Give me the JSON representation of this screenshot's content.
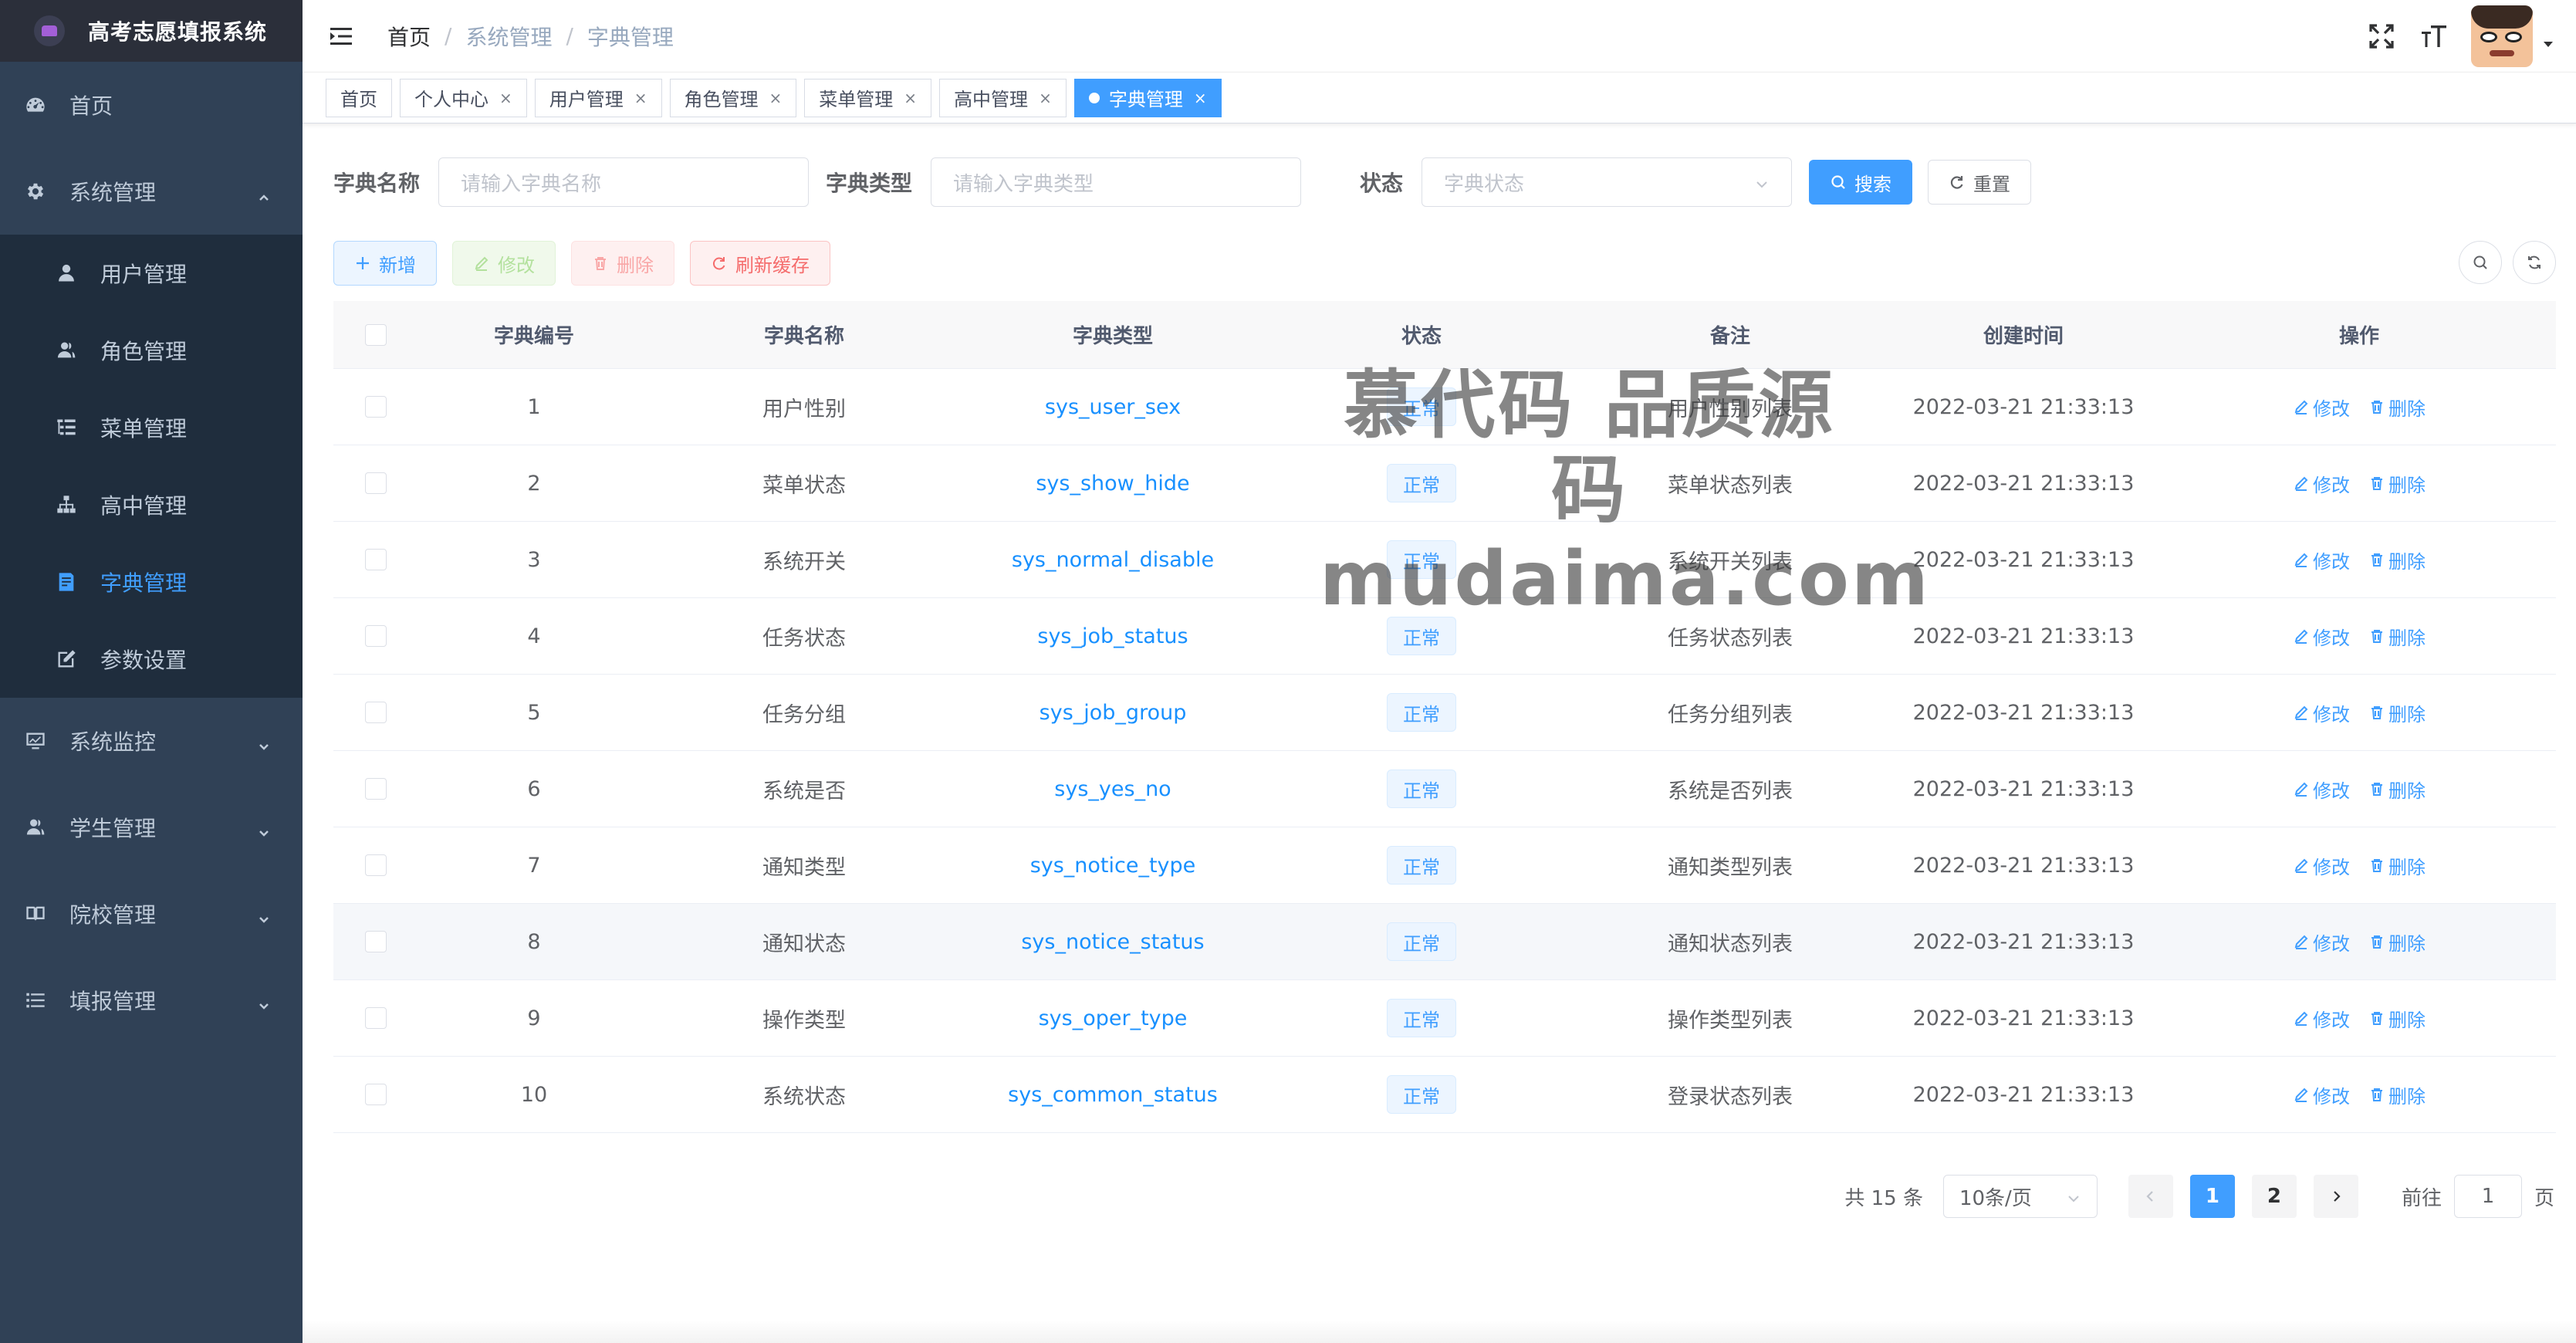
{
  "app": {
    "title": "高考志愿填报系统"
  },
  "sidebar": {
    "items": [
      {
        "label": "首页",
        "icon": "dashboard-icon"
      },
      {
        "label": "系统管理",
        "icon": "gear-icon",
        "expanded": true
      },
      {
        "label": "系统监控",
        "icon": "monitor-icon"
      },
      {
        "label": "学生管理",
        "icon": "peoples-icon"
      },
      {
        "label": "院校管理",
        "icon": "book-icon"
      },
      {
        "label": "填报管理",
        "icon": "list-icon"
      }
    ],
    "sub_items": [
      {
        "label": "用户管理",
        "icon": "user-icon"
      },
      {
        "label": "角色管理",
        "icon": "peoples-icon"
      },
      {
        "label": "菜单管理",
        "icon": "tree-table-icon"
      },
      {
        "label": "高中管理",
        "icon": "tree-icon"
      },
      {
        "label": "字典管理",
        "icon": "dict-icon",
        "active": true
      },
      {
        "label": "参数设置",
        "icon": "edit-icon"
      }
    ]
  },
  "breadcrumb": [
    "首页",
    "系统管理",
    "字典管理"
  ],
  "tags": [
    {
      "label": "首页"
    },
    {
      "label": "个人中心"
    },
    {
      "label": "用户管理"
    },
    {
      "label": "角色管理"
    },
    {
      "label": "菜单管理"
    },
    {
      "label": "高中管理"
    },
    {
      "label": "字典管理",
      "active": true
    }
  ],
  "search": {
    "name_label": "字典名称",
    "name_placeholder": "请输入字典名称",
    "type_label": "字典类型",
    "type_placeholder": "请输入字典类型",
    "status_label": "状态",
    "status_placeholder": "字典状态",
    "search_btn": "搜索",
    "reset_btn": "重置"
  },
  "toolbar": {
    "add": "新增",
    "edit": "修改",
    "delete": "删除",
    "refresh_cache": "刷新缓存"
  },
  "table": {
    "headers": [
      "字典编号",
      "字典名称",
      "字典类型",
      "状态",
      "备注",
      "创建时间",
      "操作"
    ],
    "rows": [
      {
        "id": "1",
        "name": "用户性别",
        "type": "sys_user_sex",
        "status": "正常",
        "remark": "用户性别列表",
        "time": "2022-03-21 21:33:13"
      },
      {
        "id": "2",
        "name": "菜单状态",
        "type": "sys_show_hide",
        "status": "正常",
        "remark": "菜单状态列表",
        "time": "2022-03-21 21:33:13"
      },
      {
        "id": "3",
        "name": "系统开关",
        "type": "sys_normal_disable",
        "status": "正常",
        "remark": "系统开关列表",
        "time": "2022-03-21 21:33:13"
      },
      {
        "id": "4",
        "name": "任务状态",
        "type": "sys_job_status",
        "status": "正常",
        "remark": "任务状态列表",
        "time": "2022-03-21 21:33:13"
      },
      {
        "id": "5",
        "name": "任务分组",
        "type": "sys_job_group",
        "status": "正常",
        "remark": "任务分组列表",
        "time": "2022-03-21 21:33:13"
      },
      {
        "id": "6",
        "name": "系统是否",
        "type": "sys_yes_no",
        "status": "正常",
        "remark": "系统是否列表",
        "time": "2022-03-21 21:33:13"
      },
      {
        "id": "7",
        "name": "通知类型",
        "type": "sys_notice_type",
        "status": "正常",
        "remark": "通知类型列表",
        "time": "2022-03-21 21:33:13"
      },
      {
        "id": "8",
        "name": "通知状态",
        "type": "sys_notice_status",
        "status": "正常",
        "remark": "通知状态列表",
        "time": "2022-03-21 21:33:13"
      },
      {
        "id": "9",
        "name": "操作类型",
        "type": "sys_oper_type",
        "status": "正常",
        "remark": "操作类型列表",
        "time": "2022-03-21 21:33:13"
      },
      {
        "id": "10",
        "name": "系统状态",
        "type": "sys_common_status",
        "status": "正常",
        "remark": "登录状态列表",
        "time": "2022-03-21 21:33:13"
      }
    ],
    "op_edit": "修改",
    "op_delete": "删除"
  },
  "pagination": {
    "total": "共 15 条",
    "page_size": "10条/页",
    "pages": [
      "1",
      "2"
    ],
    "current": "1",
    "goto_label": "前往",
    "goto_value": "1",
    "page_suffix": "页"
  },
  "watermark": {
    "line1": "慕代码 品质源码",
    "line2": "mudaima.com"
  },
  "colors": {
    "sidebar_bg": "#304156",
    "submenu_bg": "#1f2d3d",
    "accent": "#409eff"
  }
}
